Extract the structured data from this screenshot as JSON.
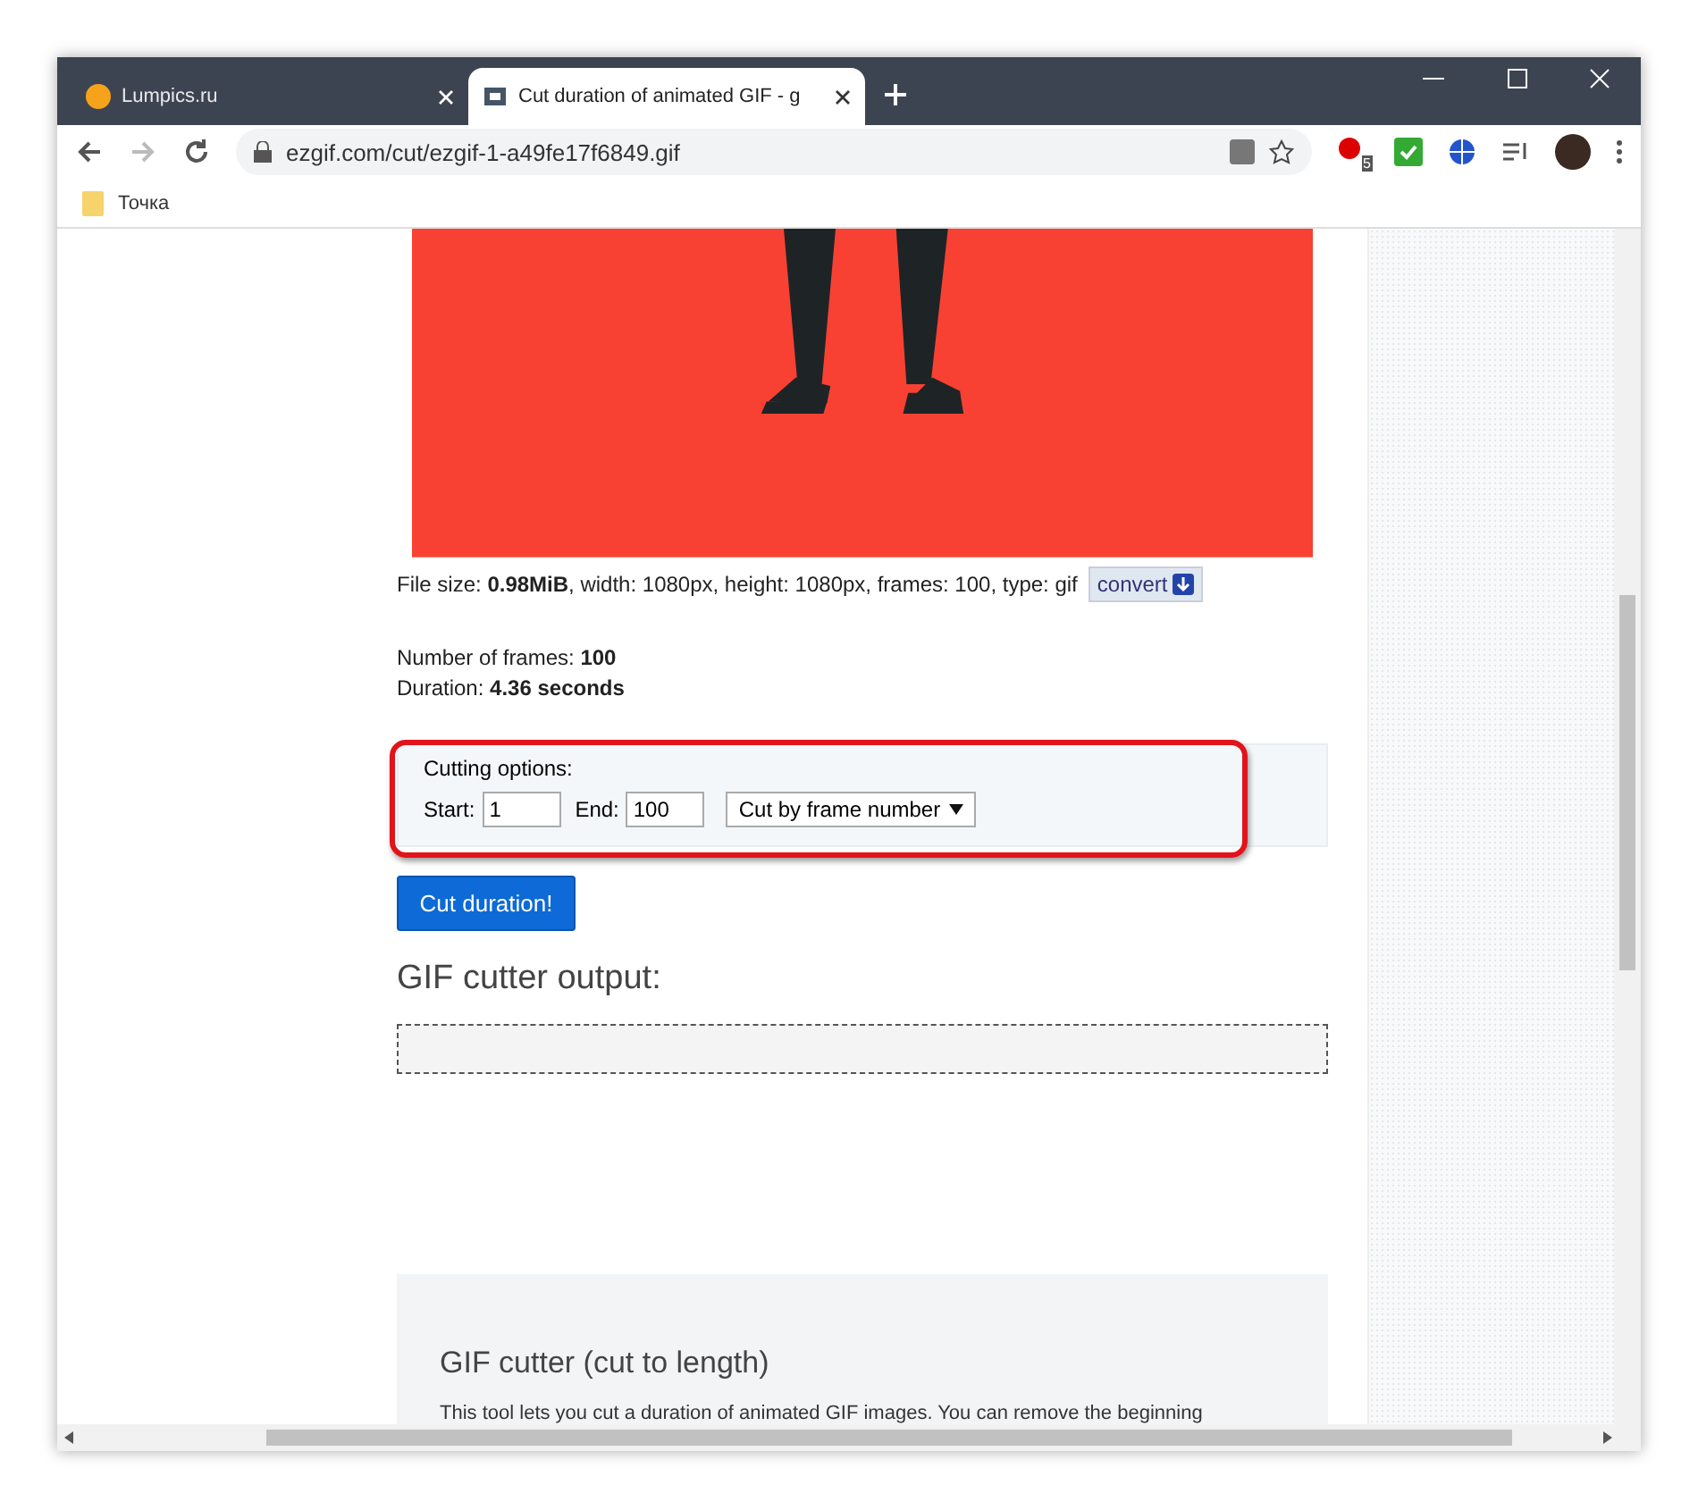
{
  "tabs": [
    {
      "title": "Lumpics.ru",
      "selected": false
    },
    {
      "title": "Cut duration of animated GIF - g",
      "selected": true
    }
  ],
  "address_bar": {
    "url": "ezgif.com/cut/ezgif-1-a49fe17f6849.gif"
  },
  "extension_badge": "5",
  "bookmarks": [
    {
      "label": "Точка"
    }
  ],
  "file_info": "File size: **0.98MiB**, width: 1080px, height: 1080px, frames: 100, type: gif",
  "convert_button": "convert",
  "frames_line": "Number of frames: **100**",
  "duration_line": "Duration: **4.36 seconds**",
  "cutting_options": {
    "title": "Cutting options:",
    "highlighted": true,
    "start_label": "Start:",
    "start_value": "1",
    "end_label": "End:",
    "end_value": "100",
    "mode": "Cut by frame number"
  },
  "submit_button": "Cut duration!",
  "output_heading": "GIF cutter output:",
  "info_heading": "GIF cutter (cut to length)",
  "info_text": "This tool lets you cut a duration of animated GIF images. You can remove the beginning"
}
